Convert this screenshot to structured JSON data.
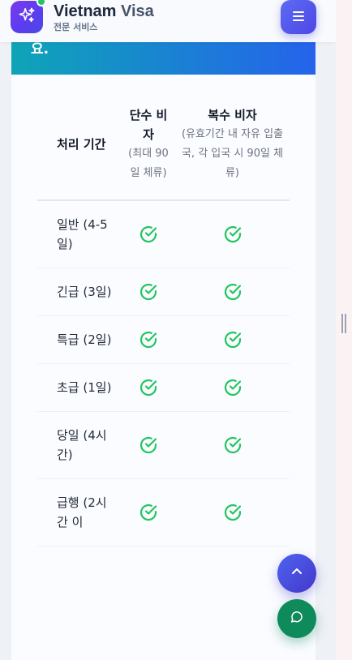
{
  "header": {
    "brand_name": "Vietnam",
    "brand_accent": "Visa",
    "brand_subtitle": "전문 서비스",
    "logo_icon": "sparkles-icon",
    "menu_icon": "hamburger-menu-icon"
  },
  "hero": {
    "partial_text": "요."
  },
  "table": {
    "headers": {
      "time": "처리 기간",
      "single_title": "단수 비자",
      "single_note": "(최대 90일 체류)",
      "multiple_title": "복수 비자",
      "multiple_note": "(유효기간 내 자유 입출국, 각 입국 시 90일 체류)"
    },
    "rows": [
      {
        "label": "일반 (4-5 일)"
      },
      {
        "label": "긴급 (3일)"
      },
      {
        "label": "특급 (2일)"
      },
      {
        "label": "초급 (1일)"
      },
      {
        "label": "당일 (4시 간)"
      },
      {
        "label": "급행 (2시 간 이"
      }
    ]
  },
  "fabs": {
    "scroll_top_icon": "chevron-up-icon",
    "chat_icon": "chat-bubble-icon"
  },
  "colors": {
    "check": "#22c55e",
    "accent": "#4f46e5",
    "chat": "#0f8a5b"
  }
}
